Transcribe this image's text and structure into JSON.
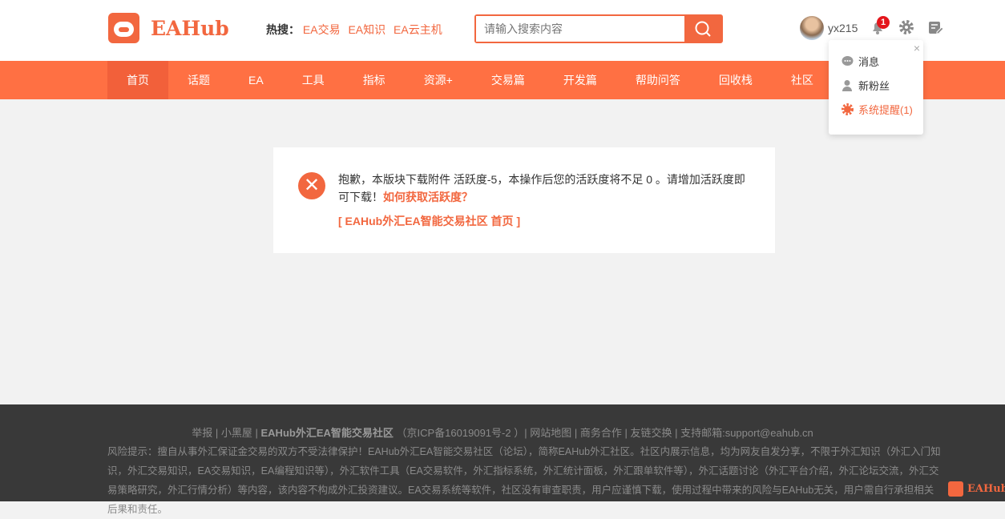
{
  "header": {
    "logo": "EAHub",
    "hot_label": "热搜：",
    "hot_links": [
      "EA交易",
      "EA知识",
      "EA云主机"
    ],
    "search_placeholder": "请输入搜索内容",
    "username": "yx215",
    "notify_count": "1"
  },
  "nav": [
    "首页",
    "话题",
    "EA",
    "工具",
    "指标",
    "资源+",
    "交易篇",
    "开发篇",
    "帮助问答",
    "回收栈",
    "社区"
  ],
  "dropdown": {
    "close": "×",
    "items": [
      "消息",
      "新粉丝",
      "系统提醒(1)"
    ]
  },
  "message": {
    "text": "抱歉，本版块下载附件 活跃度-5，本操作后您的活跃度将不足 0 。请增加活跃度即可下载！",
    "link": "如何获取活跃度？",
    "home": "[ EAHub外汇EA智能交易社区 首页 ]"
  },
  "footer": {
    "links": [
      "举报",
      "小黑屋"
    ],
    "site": "EAHub外汇EA智能交易社区",
    "icp": "（京ICP备16019091号-2 ）",
    "links2": [
      "网站地图",
      "商务合作",
      "友链交换",
      "支持邮箱:support@eahub.cn"
    ],
    "risk": "风险提示：擅自从事外汇保证金交易的双方不受法律保护！EAHub外汇EA智能交易社区（论坛），简称EAHub外汇社区。社区内展示信息，均为网友自发分享，不限于外汇知识（外汇入门知识，外汇交易知识，EA交易知识，EA编程知识等），外汇软件工具（EA交易软件，外汇指标系统，外汇统计面板，外汇跟单软件等），外汇话题讨论（外汇平台介绍，外汇论坛交流，外汇交易策略研究，外汇行情分析）等内容，该内容不构成外汇投资建议。EA交易系统等软件，社区没有审查职责，用户应谨慎下载，使用过程中带来的风险与EAHub无关，用户需自行承担相关后果和责任。",
    "logo": "EAHub"
  }
}
